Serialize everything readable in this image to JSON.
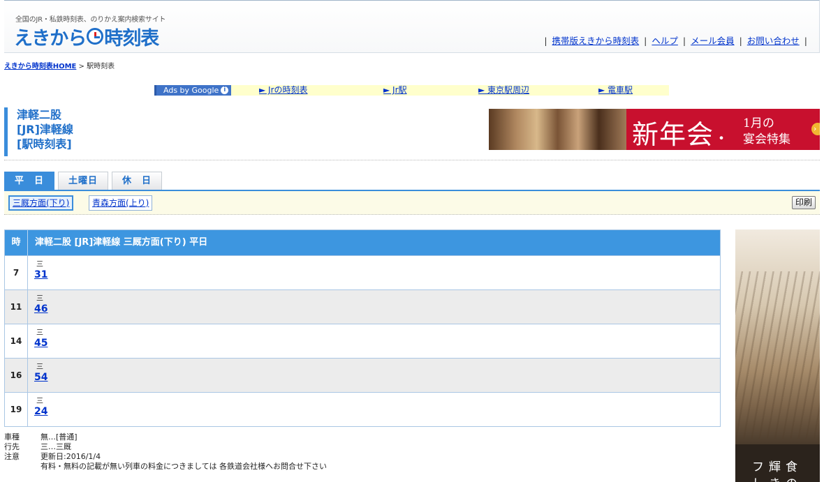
{
  "header": {
    "tagline": "全国のJR・私鉄時刻表、のりかえ案内検索サイト",
    "logo_pre": "えきから",
    "logo_post": "時刻表",
    "links": [
      "携帯版えきから時刻表",
      "ヘルプ",
      "メール会員",
      "お問い合わせ"
    ]
  },
  "breadcrumb": {
    "home": "えきから時刻表HOME",
    "sep": ">",
    "current": "駅時刻表"
  },
  "ads": {
    "badge": "Ads by Google",
    "badge_icon": "i",
    "links": [
      "► Jrの時刻表",
      "► Jr駅",
      "► 東京駅周辺",
      "► 電車駅"
    ]
  },
  "station": {
    "name": "津軽二股",
    "line": "[JR]津軽線",
    "type": "[駅時刻表]"
  },
  "banner": {
    "big": "新年会",
    "dot": "・",
    "small1": "1月の",
    "small2": "宴会特集",
    "arrow": "›"
  },
  "day_tabs": [
    "平　日",
    "土曜日",
    "休　日"
  ],
  "directions": [
    "三厩方面(下り)",
    "青森方面(上り)"
  ],
  "print_label": "印刷",
  "timetable": {
    "hour_header": "時",
    "title": "津軽二股 [JR]津軽線 三厩方面(下り) 平日",
    "rows": [
      {
        "hour": "7",
        "dest": "三",
        "minute": "31"
      },
      {
        "hour": "11",
        "dest": "三",
        "minute": "46"
      },
      {
        "hour": "14",
        "dest": "三",
        "minute": "45"
      },
      {
        "hour": "16",
        "dest": "三",
        "minute": "54"
      },
      {
        "hour": "19",
        "dest": "三",
        "minute": "24"
      }
    ]
  },
  "legend": {
    "type_key": "車種",
    "type_val": "無…[普通]",
    "dest_key": "行先",
    "dest_val": "三…三厩",
    "note_key": "注意",
    "note_val1": "更新日:2016/1/4",
    "note_val2": "有料・無料の記載が無い列車の料金につきましては 各鉄道会社様へお問合せ下さい"
  },
  "side_ad": {
    "line1": "フ輝食",
    "line2": "しきの"
  },
  "colors": {
    "accent": "#3a8ddb",
    "link": "#0033cc",
    "banner": "#c8102e"
  }
}
